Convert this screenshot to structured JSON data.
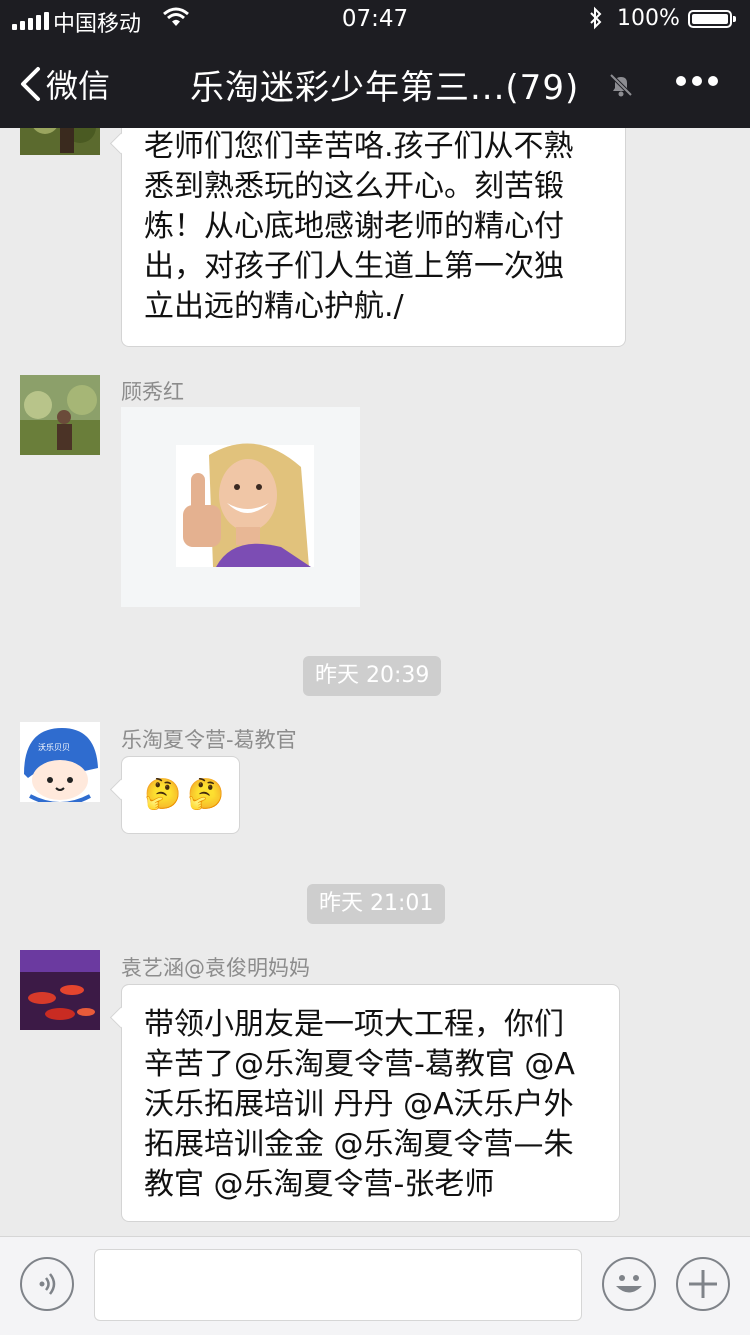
{
  "status_bar": {
    "carrier": "中国移动",
    "time": "07:47",
    "battery": "100%"
  },
  "nav": {
    "back_label": "微信",
    "title": "乐淘迷彩少年第三...(79)"
  },
  "messages": [
    {
      "sender": "",
      "lines": [
        "老师们您们幸苦咯.孩子们从不熟",
        "悉到熟悉玩的这么开心。刻苦锻",
        "炼！从心底地感谢老师的精心付",
        "出，对孩子们人生道上第一次独",
        "立出远的精心护航./"
      ]
    },
    {
      "sender": "顾秀红",
      "type": "image",
      "image_icon": "thumbs-up-woman-sticker"
    },
    {
      "time": "昨天 20:39"
    },
    {
      "sender": "乐淘夏令营-葛教官",
      "avatar_badge": "沃乐贝贝",
      "emoji": [
        "🤔",
        "🤔"
      ]
    },
    {
      "time": "昨天 21:01"
    },
    {
      "sender": "袁艺涵@袁俊明妈妈",
      "lines": [
        "带领小朋友是一项大工程，你们",
        "辛苦了@乐淘夏令营-葛教官 @A",
        "沃乐拓展培训 丹丹 @A沃乐户外",
        "拓展培训金金 @乐淘夏令营—朱",
        "教官 @乐淘夏令营-张老师"
      ]
    }
  ],
  "input_bar": {
    "voice_icon": "voice-icon",
    "emoji_icon": "smiley-icon",
    "plus_icon": "plus-icon"
  },
  "colors": {
    "header_bg": "#1d1d22",
    "chat_bg": "#ebebeb",
    "bubble_bg": "#ffffff",
    "time_pill_bg": "#cecece"
  }
}
